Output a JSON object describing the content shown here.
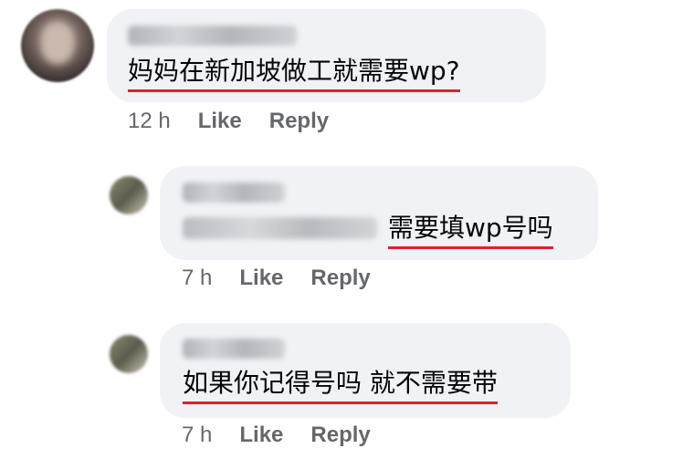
{
  "comments": [
    {
      "text": "妈妈在新加坡做工就需要wp?",
      "time": "12 h",
      "like_label": "Like",
      "reply_label": "Reply"
    },
    {
      "text": "需要填wp号吗",
      "time": "7 h",
      "like_label": "Like",
      "reply_label": "Reply"
    },
    {
      "text": "如果你记得号吗 就不需要带",
      "time": "7 h",
      "like_label": "Like",
      "reply_label": "Reply"
    }
  ],
  "colors": {
    "bubble_bg": "#f0f2f5",
    "meta_text": "#65676b",
    "underline": "#e0202e"
  }
}
